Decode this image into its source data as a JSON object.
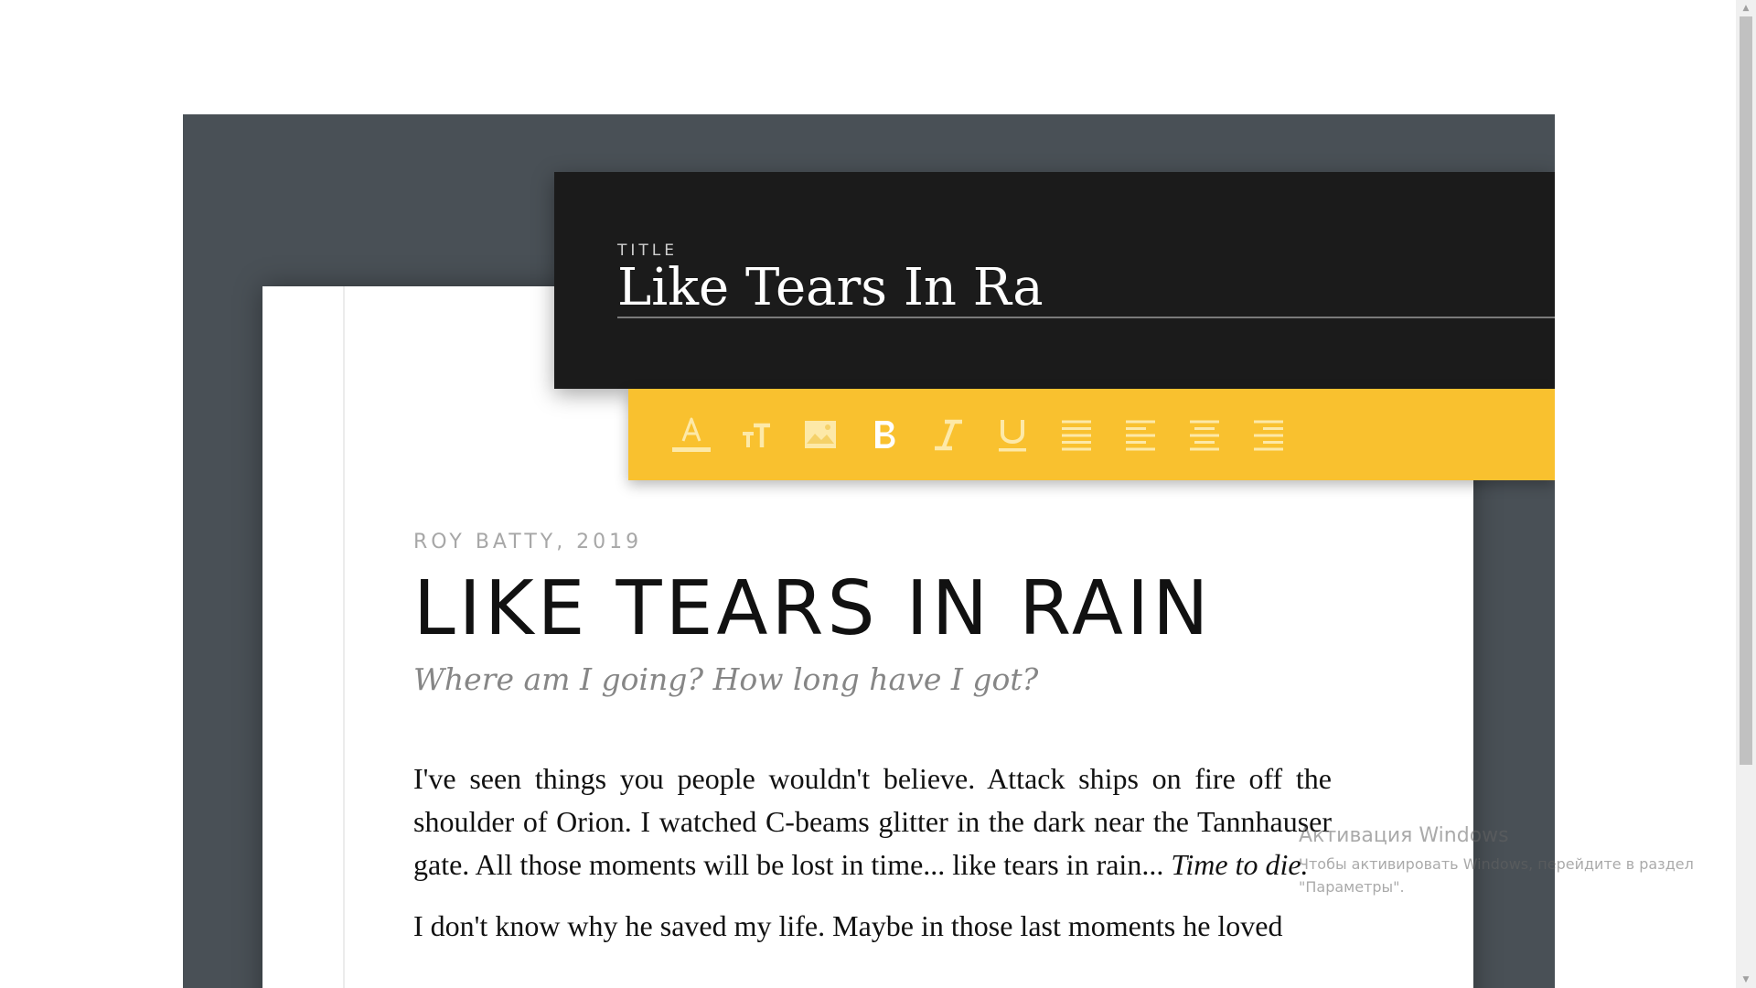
{
  "editor": {
    "title_label": "TITLE",
    "title_value": "Like Tears In Ra"
  },
  "toolbar": {
    "tools": [
      {
        "name": "text-color",
        "icon": "text-color-icon"
      },
      {
        "name": "text-size",
        "icon": "text-size-icon"
      },
      {
        "name": "insert-image",
        "icon": "image-icon"
      },
      {
        "name": "bold",
        "icon": "bold-icon"
      },
      {
        "name": "italic",
        "icon": "italic-icon"
      },
      {
        "name": "underline",
        "icon": "underline-icon"
      },
      {
        "name": "align-justify",
        "icon": "align-justify-icon"
      },
      {
        "name": "align-left",
        "icon": "align-left-icon"
      },
      {
        "name": "align-center",
        "icon": "align-center-icon"
      },
      {
        "name": "align-right",
        "icon": "align-right-icon"
      }
    ],
    "accent_color": "#f9c12f"
  },
  "article": {
    "byline": "ROY BATTY, 2019",
    "headline": "LIKE TEARS IN RAIN",
    "subtitle": "Where am I going? How long have I got?",
    "paragraph1_main": "I've seen things you people wouldn't believe. Attack ships on fire off the shoulder of Orion. I watched C-beams glitter in the dark near the Tannhauser gate. All those moments will be lost in time... like tears in rain...",
    "paragraph1_italic": "Time to die.",
    "paragraph2": "I don't know why he saved my life. Maybe in those last moments he loved"
  },
  "os_notice": {
    "title": "Активация Windows",
    "text": "Чтобы активировать Windows, перейдите в раздел \"Параметры\"."
  },
  "colors": {
    "frame": "#495056",
    "title_panel": "#1b1b1b",
    "toolbar": "#f9c12f"
  }
}
